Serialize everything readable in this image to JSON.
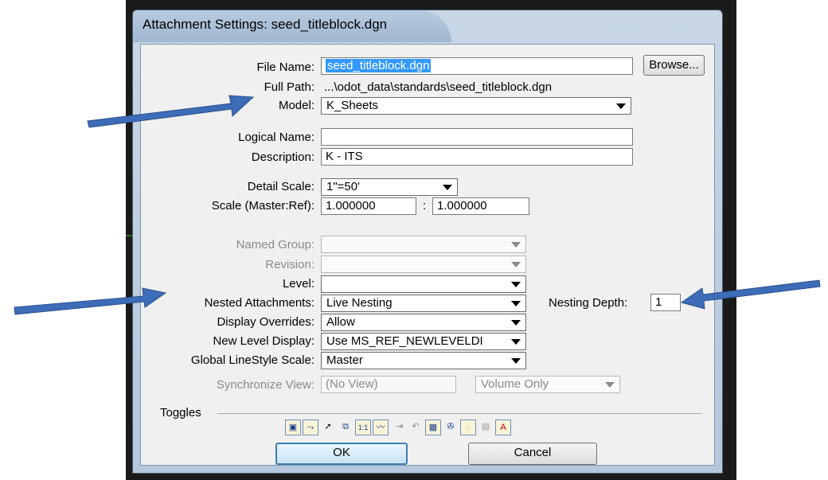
{
  "dialog": {
    "title": "Attachment Settings: seed_titleblock.dgn"
  },
  "form": {
    "file_name_label": "File Name:",
    "file_name_value": "seed_titleblock.dgn",
    "browse_label": "Browse...",
    "full_path_label": "Full Path:",
    "full_path_value": "...\\odot_data\\standards\\seed_titleblock.dgn",
    "model_label": "Model:",
    "model_value": "K_Sheets",
    "logical_name_label": "Logical Name:",
    "logical_name_value": "",
    "description_label": "Description:",
    "description_value": "K - ITS",
    "detail_scale_label": "Detail Scale:",
    "detail_scale_value": "1\"=50'",
    "scale_label": "Scale (Master:Ref):",
    "scale_master": "1.000000",
    "scale_sep": ":",
    "scale_ref": "1.000000",
    "named_group_label": "Named Group:",
    "named_group_value": "",
    "revision_label": "Revision:",
    "revision_value": "",
    "level_label": "Level:",
    "level_value": "",
    "nested_label": "Nested Attachments:",
    "nested_value": "Live Nesting",
    "nesting_depth_label": "Nesting Depth:",
    "nesting_depth_value": "1",
    "display_overrides_label": "Display Overrides:",
    "display_overrides_value": "Allow",
    "new_level_label": "New Level Display:",
    "new_level_value": "Use MS_REF_NEWLEVELDI",
    "global_ls_label": "Global LineStyle Scale:",
    "global_ls_value": "Master",
    "sync_view_label": "Synchronize View:",
    "sync_view_value": "(No View)",
    "sync_view_option": "Volume Only"
  },
  "toggles": {
    "label": "Toggles",
    "items": [
      "display-toggle",
      "snap-toggle",
      "locate-toggle",
      "treat-as-element-toggle",
      "true-scale-toggle",
      "scale-line-styles-toggle",
      "ignore-attachments-toggle",
      "clipping-toggle",
      "raster-toggle",
      "display-raster-toggle",
      "use-lights-toggle",
      "display-print-toggle",
      "annotation-toggle"
    ]
  },
  "buttons": {
    "ok": "OK",
    "cancel": "Cancel"
  }
}
